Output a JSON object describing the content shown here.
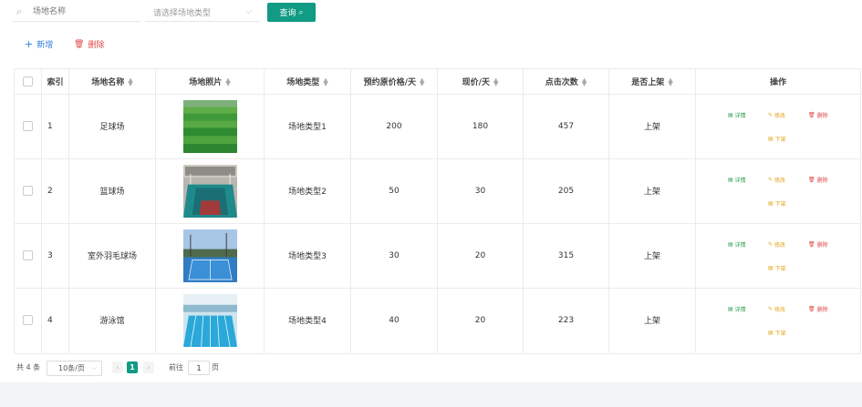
{
  "search": {
    "name_placeholder": "场地名称",
    "type_placeholder": "请选择场地类型",
    "query_label": "查询"
  },
  "toolbar": {
    "add_label": "新增",
    "delete_label": "删除"
  },
  "table": {
    "headers": {
      "index": "索引",
      "name": "场地名称",
      "photo": "场地照片",
      "type": "场地类型",
      "orig_price": "预约原价格/天",
      "price": "现价/天",
      "clicks": "点击次数",
      "listed": "是否上架",
      "actions": "操作"
    },
    "actions": {
      "detail": "详情",
      "edit": "修改",
      "delete": "删除",
      "off": "下架"
    },
    "rows": [
      {
        "index": "1",
        "name": "足球场",
        "type": "场地类型1",
        "orig_price": "200",
        "price": "180",
        "clicks": "457",
        "listed": "上架",
        "thumb": "football"
      },
      {
        "index": "2",
        "name": "篮球场",
        "type": "场地类型2",
        "orig_price": "50",
        "price": "30",
        "clicks": "205",
        "listed": "上架",
        "thumb": "basketball"
      },
      {
        "index": "3",
        "name": "室外羽毛球场",
        "type": "场地类型3",
        "orig_price": "30",
        "price": "20",
        "clicks": "315",
        "listed": "上架",
        "thumb": "badminton"
      },
      {
        "index": "4",
        "name": "游泳馆",
        "type": "场地类型4",
        "orig_price": "40",
        "price": "20",
        "clicks": "223",
        "listed": "上架",
        "thumb": "pool"
      }
    ]
  },
  "pagination": {
    "total": "共 4 条",
    "page_size": "10条/页",
    "current": "1",
    "goto_prefix": "前往",
    "goto_value": "1",
    "goto_suffix": "页"
  },
  "colors": {
    "primary": "#119b84",
    "link_blue": "#2f7fd8",
    "danger": "#e04848",
    "warning": "#e6a417",
    "success": "#2a9d4b"
  }
}
